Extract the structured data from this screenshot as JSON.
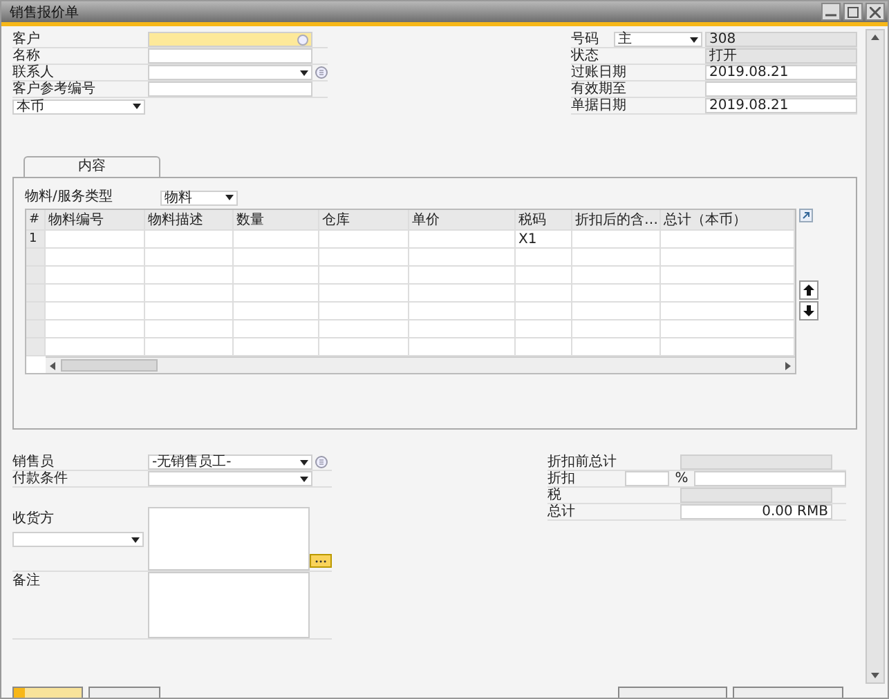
{
  "window": {
    "title": "销售报价单"
  },
  "header_left": [
    {
      "label": "客户",
      "kind": "lookup"
    },
    {
      "label": "名称",
      "kind": "text"
    },
    {
      "label": "联系人",
      "kind": "dropdown_info"
    },
    {
      "label": "客户参考编号",
      "kind": "text"
    }
  ],
  "currency": {
    "value": "本币"
  },
  "header_right": [
    {
      "label": "号码",
      "kind": "series",
      "series": "主",
      "value": "308"
    },
    {
      "label": "状态",
      "kind": "readonly",
      "value": "打开"
    },
    {
      "label": "过账日期",
      "kind": "text",
      "value": "2019.08.21"
    },
    {
      "label": "有效期至",
      "kind": "text"
    },
    {
      "label": "单据日期",
      "kind": "text",
      "value": "2019.08.21"
    }
  ],
  "tabs": [
    {
      "label": "内容",
      "selected": true
    }
  ],
  "item_type": {
    "label": "物料/服务类型",
    "value": "物料"
  },
  "table": {
    "columns": [
      "#",
      "物料编号",
      "物料描述",
      "数量",
      "仓库",
      "单价",
      "税码",
      "折扣后的含…",
      "总计（本币）"
    ],
    "rows": [
      {
        "cells": {
          "0": "1",
          "6": "X1"
        }
      }
    ]
  },
  "footer_left": [
    {
      "label": "销售员",
      "kind": "dropdown_info",
      "value": "-无销售员工-"
    },
    {
      "label": "付款条件",
      "kind": "dropdown"
    }
  ],
  "ship_to": {
    "label": "收货方"
  },
  "remarks": {
    "label": "备注"
  },
  "totals": [
    {
      "label": "折扣前总计",
      "kind": "readonly"
    },
    {
      "label": "折扣",
      "kind": "percent",
      "unit": "%"
    },
    {
      "label": "税",
      "kind": "readonly"
    },
    {
      "label": "总计",
      "kind": "text",
      "value": "0.00 RMB"
    }
  ]
}
